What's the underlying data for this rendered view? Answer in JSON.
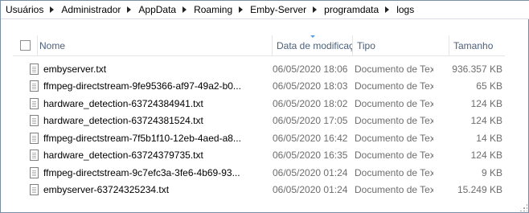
{
  "breadcrumb": [
    "Usuários",
    "Administrador",
    "AppData",
    "Roaming",
    "Emby-Server",
    "programdata",
    "logs"
  ],
  "columns": {
    "name": "Nome",
    "date": "Data de modificação",
    "type": "Tipo",
    "size": "Tamanho"
  },
  "files": [
    {
      "name": "embyserver.txt",
      "date": "06/05/2020 18:06",
      "type": "Documento de Texto",
      "size": "936.357 KB"
    },
    {
      "name": "ffmpeg-directstream-9fe95366-af97-49a2-b0...",
      "date": "06/05/2020 18:03",
      "type": "Documento de Texto",
      "size": "65 KB"
    },
    {
      "name": "hardware_detection-63724384941.txt",
      "date": "06/05/2020 18:02",
      "type": "Documento de Texto",
      "size": "124 KB"
    },
    {
      "name": "hardware_detection-63724381524.txt",
      "date": "06/05/2020 17:05",
      "type": "Documento de Texto",
      "size": "124 KB"
    },
    {
      "name": "ffmpeg-directstream-7f5b1f10-12eb-4aed-a8...",
      "date": "06/05/2020 16:42",
      "type": "Documento de Texto",
      "size": "14 KB"
    },
    {
      "name": "hardware_detection-63724379735.txt",
      "date": "06/05/2020 16:35",
      "type": "Documento de Texto",
      "size": "124 KB"
    },
    {
      "name": "ffmpeg-directstream-9c7efc3a-3fe6-4b69-93...",
      "date": "06/05/2020 01:24",
      "type": "Documento de Texto",
      "size": "9 KB"
    },
    {
      "name": "embyserver-63724325234.txt",
      "date": "06/05/2020 01:24",
      "type": "Documento de Texto",
      "size": "15.249 KB"
    }
  ],
  "icons": {
    "file": "text-document-icon",
    "separator": "chevron-right-icon",
    "sort": "sort-descending-icon"
  }
}
